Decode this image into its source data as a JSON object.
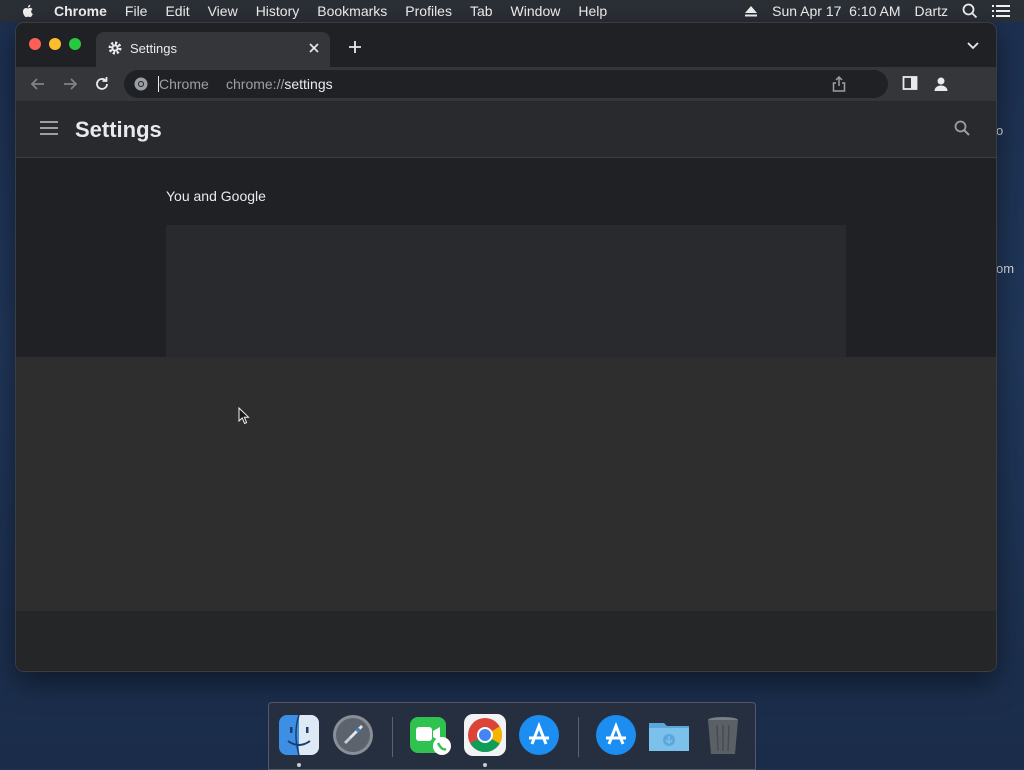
{
  "menubar": {
    "app_name": "Chrome",
    "items": [
      "File",
      "Edit",
      "View",
      "History",
      "Bookmarks",
      "Profiles",
      "Tab",
      "Window",
      "Help"
    ],
    "datetime": "Sun Apr 17  6:10 AM",
    "user": "Dartz"
  },
  "desktop": {
    "edge_text_1": "o",
    "edge_text_2": "om"
  },
  "browser": {
    "tab": {
      "title": "Settings",
      "icon": "gear-icon"
    },
    "omnibox": {
      "site_name": "Chrome",
      "url_scheme": "chrome://",
      "url_path": "settings"
    }
  },
  "settings": {
    "title": "Settings",
    "section_title": "You and Google"
  },
  "dock": {
    "items": [
      "Finder",
      "Launchpad",
      "FaceTime",
      "Google Chrome",
      "App Store",
      "App Store",
      "Downloads",
      "Trash"
    ]
  },
  "colors": {
    "page_bg": "#202124",
    "header_bg": "#292a2d",
    "toolbar_bg": "#35363a",
    "desktop_bg": "#1c2f4f"
  }
}
